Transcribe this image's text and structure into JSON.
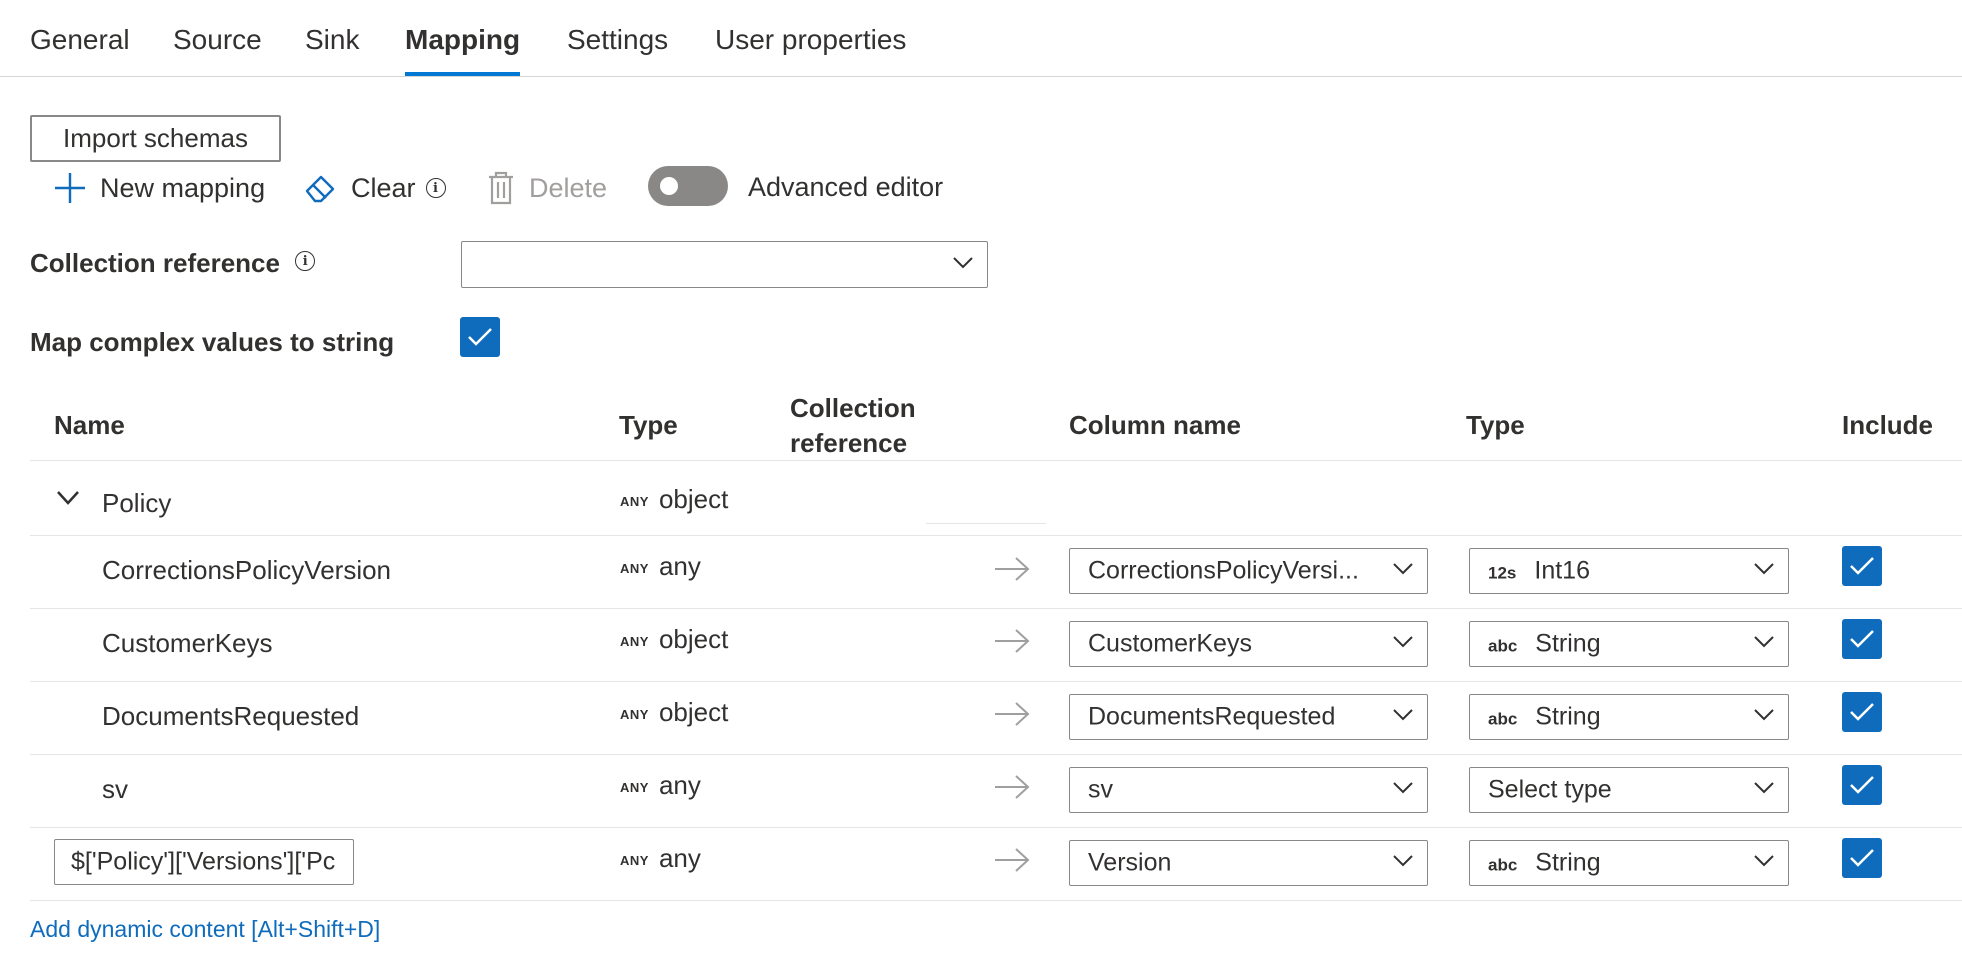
{
  "tabs": [
    {
      "label": "General"
    },
    {
      "label": "Source"
    },
    {
      "label": "Sink"
    },
    {
      "label": "Mapping"
    },
    {
      "label": "Settings"
    },
    {
      "label": "User properties"
    }
  ],
  "active_tab": "Mapping",
  "toolbar": {
    "import_schemas": "Import schemas",
    "new_mapping": "New mapping",
    "clear": "Clear",
    "delete": "Delete",
    "advanced_editor": "Advanced editor",
    "advanced_editor_on": false
  },
  "form": {
    "collection_reference_label": "Collection reference",
    "collection_reference_value": "",
    "map_complex_label": "Map complex values to string",
    "map_complex_checked": true
  },
  "table": {
    "headers": {
      "name": "Name",
      "type": "Type",
      "collection_reference": "Collection reference",
      "column_name": "Column name",
      "sink_type": "Type",
      "include": "Include"
    },
    "group": {
      "name": "Policy",
      "any_tag": "ANY",
      "type": "object"
    },
    "rows": [
      {
        "name": "CorrectionsPolicyVersion",
        "any_tag": "ANY",
        "type": "any",
        "column": "CorrectionsPolicyVersi...",
        "sink_type_tag": "12s",
        "sink_type": "Int16",
        "include": true
      },
      {
        "name": "CustomerKeys",
        "any_tag": "ANY",
        "type": "object",
        "column": "CustomerKeys",
        "sink_type_tag": "abc",
        "sink_type": "String",
        "include": true
      },
      {
        "name": "DocumentsRequested",
        "any_tag": "ANY",
        "type": "object",
        "column": "DocumentsRequested",
        "sink_type_tag": "abc",
        "sink_type": "String",
        "include": true
      },
      {
        "name": "sv",
        "any_tag": "ANY",
        "type": "any",
        "column": "sv",
        "sink_type_tag": "",
        "sink_type": "Select type",
        "include": true
      },
      {
        "name": "$['Policy']['Versions']['Pc",
        "any_tag": "ANY",
        "type": "any",
        "column": "Version",
        "sink_type_tag": "abc",
        "sink_type": "String",
        "include": true
      }
    ]
  },
  "add_dynamic_content": "Add dynamic content [Alt+Shift+D]",
  "colors": {
    "accent": "#0078d4",
    "checkbox": "#0f6cbd",
    "toggle_off": "#8a8886",
    "link": "#0f6cbd"
  }
}
